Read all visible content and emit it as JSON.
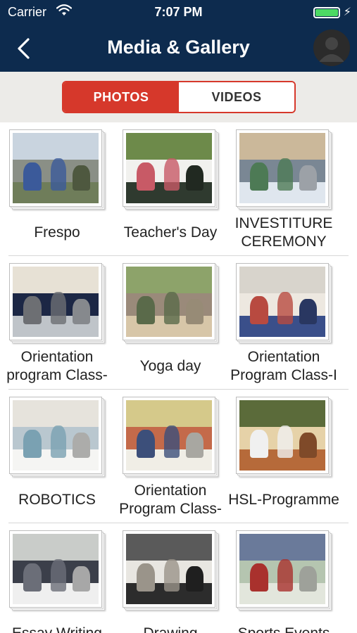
{
  "status_bar": {
    "carrier": "Carrier",
    "time": "7:07 PM",
    "bolt": "⚡"
  },
  "nav": {
    "title": "Media & Gallery",
    "back_icon": "chevron-left-icon",
    "avatar_icon": "user-avatar-icon"
  },
  "tabs": {
    "photos": "PHOTOS",
    "videos": "VIDEOS",
    "active": "PHOTOS"
  },
  "colors": {
    "nav_bg": "#0d2b4e",
    "accent": "#d6382b",
    "battery": "#4cd964"
  },
  "albums": [
    {
      "title": "Frespo"
    },
    {
      "title": "Teacher's Day"
    },
    {
      "title": "INVESTITURE CEREMONY"
    },
    {
      "title": "Orientation program Class-"
    },
    {
      "title": "Yoga day"
    },
    {
      "title": "Orientation Program Class-I"
    },
    {
      "title": "ROBOTICS"
    },
    {
      "title": "Orientation Program Class-"
    },
    {
      "title": "HSL-Programme"
    },
    {
      "title": "Essay Writing"
    },
    {
      "title": "Drawing"
    },
    {
      "title": "Sports Events"
    }
  ]
}
